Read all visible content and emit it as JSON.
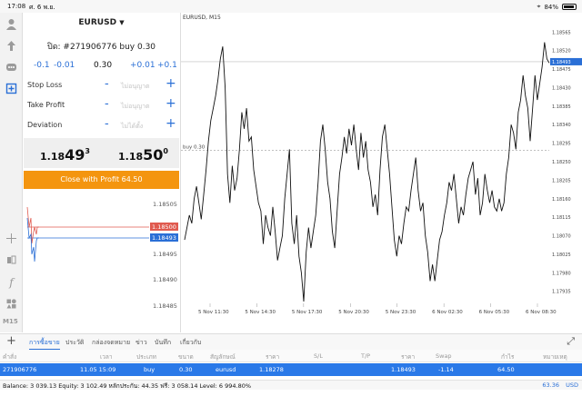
{
  "status_bar": {
    "time": "17:08",
    "date": "ศ. 6 พ.ย.",
    "battery": "84%"
  },
  "toolbar": {
    "timeframe": "M15"
  },
  "order_panel": {
    "symbol": "EURUSD",
    "title": "ปิด: #271906776 buy 0.30",
    "volume_steps": [
      "-0.1",
      "-0.01",
      "0.30",
      "+0.01",
      "+0.1"
    ],
    "stop_loss": {
      "label": "Stop Loss",
      "value": "ไม่อนุญาต"
    },
    "take_profit": {
      "label": "Take Profit",
      "value": "ไม่อนุญาต"
    },
    "deviation": {
      "label": "Deviation",
      "value": "ไม่ได้ตั้ง"
    },
    "bid": {
      "prefix": "1.18",
      "big": "49",
      "sup": "3"
    },
    "ask": {
      "prefix": "1.18",
      "big": "50",
      "sup": "0"
    },
    "close_button": "Close with Profit 64.50"
  },
  "mini_chart": {
    "price_labels": [
      "1.18505",
      "1.18495",
      "1.18490",
      "1.18485"
    ],
    "ask_label": "1.18500",
    "bid_label": "1.18493"
  },
  "chart_data": {
    "type": "line",
    "title": "EURUSD, M15",
    "y_ticks": [
      "1.18565",
      "1.18520",
      "1.18475",
      "1.18430",
      "1.18385",
      "1.18340",
      "1.18295",
      "1.18250",
      "1.18205",
      "1.18160",
      "1.18115",
      "1.18070",
      "1.18025",
      "1.17980",
      "1.17935"
    ],
    "x_ticks": [
      "5 Nov 11:30",
      "5 Nov 14:30",
      "5 Nov 17:30",
      "5 Nov 20:30",
      "5 Nov 23:30",
      "6 Nov 02:30",
      "6 Nov 05:30",
      "6 Nov 08:30"
    ],
    "ylim": [
      1.1791,
      1.1859
    ],
    "current_price_label": "1.18493",
    "current_price": 1.18493,
    "trade_line_label": "buy 0.30",
    "trade_price": 1.18278,
    "series": [
      {
        "values": [
          1.1806,
          1.1809,
          1.1812,
          1.181,
          1.1816,
          1.1819,
          1.1815,
          1.1811,
          1.1817,
          1.1823,
          1.183,
          1.1835,
          1.1838,
          1.1841,
          1.1845,
          1.185,
          1.1853,
          1.1843,
          1.1822,
          1.1815,
          1.1824,
          1.1818,
          1.1821,
          1.1828,
          1.1837,
          1.1833,
          1.1838,
          1.183,
          1.1831,
          1.1823,
          1.1819,
          1.1815,
          1.1813,
          1.1805,
          1.1812,
          1.1809,
          1.1807,
          1.1814,
          1.1808,
          1.1801,
          1.1804,
          1.1807,
          1.1816,
          1.1822,
          1.1828,
          1.181,
          1.1805,
          1.1812,
          1.1802,
          1.1798,
          1.1791,
          1.1803,
          1.1809,
          1.1804,
          1.1808,
          1.1812,
          1.182,
          1.183,
          1.1834,
          1.1828,
          1.182,
          1.1816,
          1.1808,
          1.1804,
          1.1813,
          1.1822,
          1.1826,
          1.1831,
          1.1827,
          1.1833,
          1.1829,
          1.1834,
          1.1828,
          1.1823,
          1.1832,
          1.1826,
          1.183,
          1.1823,
          1.182,
          1.1814,
          1.1817,
          1.1812,
          1.1823,
          1.1831,
          1.1834,
          1.1828,
          1.1822,
          1.1814,
          1.1806,
          1.1802,
          1.1807,
          1.1805,
          1.181,
          1.1814,
          1.1813,
          1.1818,
          1.1822,
          1.1826,
          1.1818,
          1.1813,
          1.1815,
          1.1807,
          1.1803,
          1.1796,
          1.18,
          1.1796,
          1.1801,
          1.1806,
          1.1808,
          1.1812,
          1.1815,
          1.182,
          1.1818,
          1.1822,
          1.1816,
          1.181,
          1.1814,
          1.1812,
          1.1817,
          1.1821,
          1.1823,
          1.1825,
          1.1817,
          1.1821,
          1.1812,
          1.1815,
          1.1822,
          1.1818,
          1.1815,
          1.1818,
          1.1814,
          1.1813,
          1.1816,
          1.1813,
          1.1815,
          1.1822,
          1.1826,
          1.1834,
          1.1832,
          1.1828,
          1.1837,
          1.184,
          1.1846,
          1.1841,
          1.1838,
          1.183,
          1.1838,
          1.1846,
          1.184,
          1.1844,
          1.1848,
          1.1854,
          1.185,
          1.1849
        ]
      }
    ]
  },
  "tabs": [
    "การซื้อขาย",
    "ประวัติ",
    "กล่องจดหมาย",
    "ข่าว",
    "บันทึก",
    "เกี่ยวกับ"
  ],
  "table": {
    "headers": [
      "คำสั่ง",
      "เวลา",
      "ประเภท",
      "ขนาด",
      "สัญลักษณ์",
      "ราคา",
      "S/L",
      "T/P",
      "ราคา",
      "Swap",
      "กำไร",
      "หมายเหตุ"
    ],
    "row": [
      "271906776",
      "11.05 15:09",
      "buy",
      "0.30",
      "eurusd",
      "1.18278",
      "",
      "",
      "1.18493",
      "-1.14",
      "64.50",
      ""
    ]
  },
  "footer": {
    "balance": "Balance: 3 039.13 Equity: 3 102.49 หลักประกัน: 44.35 ฟรี: 3 058.14 Level: 6 994.80%",
    "profit": "63.36",
    "currency": "USD"
  },
  "colors": {
    "accent": "#2a6fd6",
    "orange": "#f4950f",
    "red": "#e05a4f",
    "selected_row": "#2a79e8"
  }
}
